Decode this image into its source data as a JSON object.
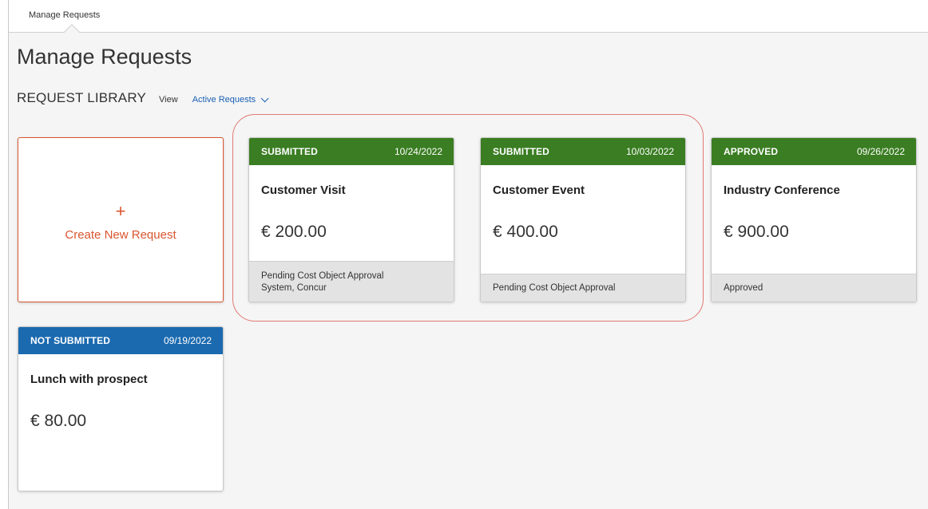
{
  "breadcrumb": {
    "label": "Manage Requests"
  },
  "page": {
    "title": "Manage Requests"
  },
  "library": {
    "title": "REQUEST LIBRARY",
    "view_label": "View",
    "view_selected": "Active Requests"
  },
  "create": {
    "plus": "+",
    "label": "Create New Request"
  },
  "colors": {
    "submitted": "#3a7d22",
    "approved": "#3a7d22",
    "not_submitted": "#1b6ab0",
    "accent": "#d9552f",
    "highlight": "#e07a72"
  },
  "requests": [
    {
      "status": "SUBMITTED",
      "date": "10/24/2022",
      "name": "Customer Visit",
      "amount": "€ 200.00",
      "footer_line1": "Pending Cost Object Approval",
      "footer_line2": "System, Concur"
    },
    {
      "status": "SUBMITTED",
      "date": "10/03/2022",
      "name": "Customer Event",
      "amount": "€ 400.00",
      "footer_line1": "Pending Cost Object Approval"
    },
    {
      "status": "APPROVED",
      "date": "09/26/2022",
      "name": "Industry Conference",
      "amount": "€ 900.00",
      "footer_line1": "Approved"
    },
    {
      "status": "NOT SUBMITTED",
      "date": "09/19/2022",
      "name": "Lunch with prospect",
      "amount": "€ 80.00"
    }
  ]
}
